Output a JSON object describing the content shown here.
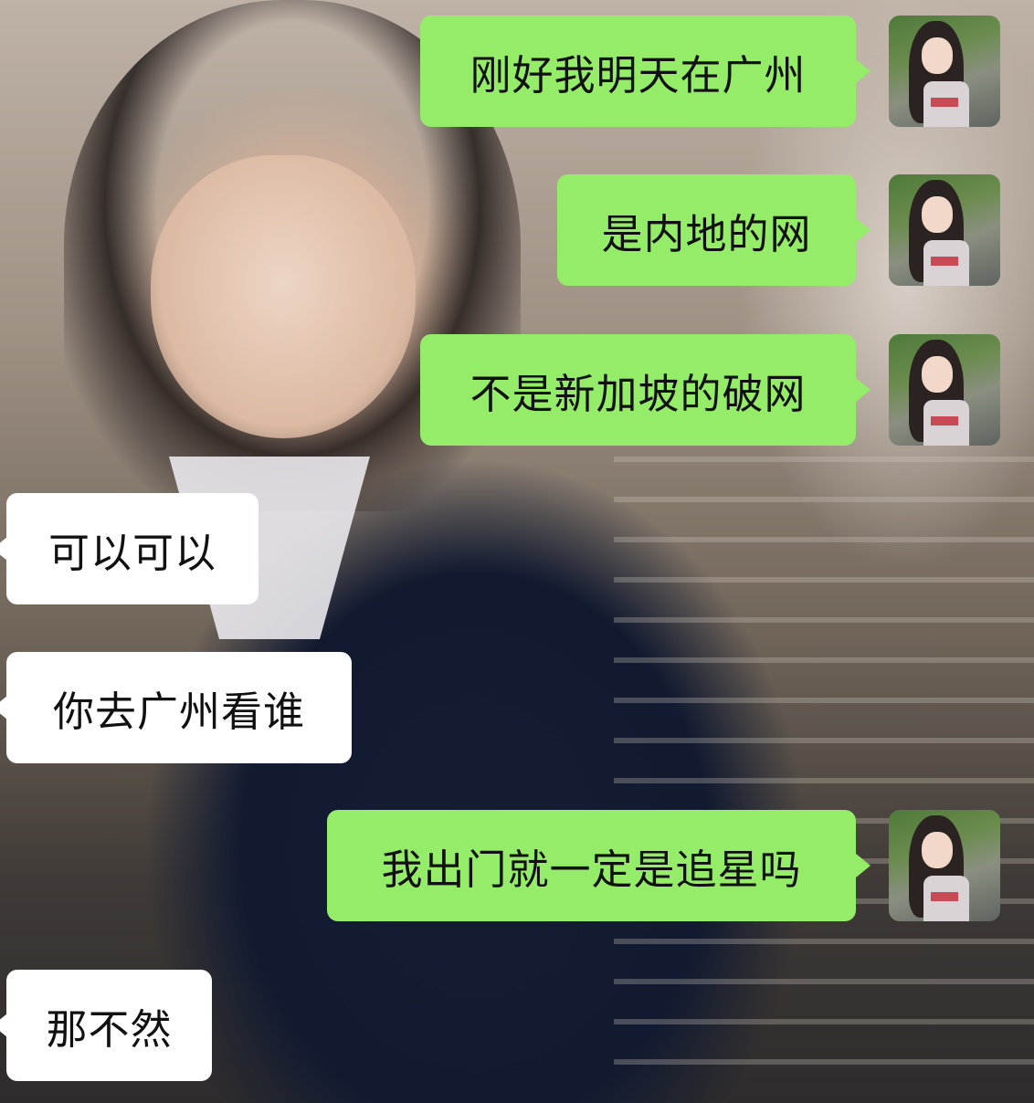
{
  "chat": {
    "messages": [
      {
        "side": "sent",
        "text": "刚好我明天在广州",
        "avatar": "avatar-photo"
      },
      {
        "side": "sent",
        "text": "是内地的网",
        "avatar": "avatar-photo"
      },
      {
        "side": "sent",
        "text": "不是新加坡的破网",
        "avatar": "avatar-photo"
      },
      {
        "side": "received",
        "text": "可以可以"
      },
      {
        "side": "received",
        "text": "你去广州看谁"
      },
      {
        "side": "sent",
        "text": "我出门就一定是追星吗",
        "avatar": "avatar-photo"
      },
      {
        "side": "received",
        "text": "那不然"
      }
    ],
    "colors": {
      "sent_bubble": "#95ec69",
      "received_bubble": "#ffffff",
      "text": "#111111"
    }
  }
}
